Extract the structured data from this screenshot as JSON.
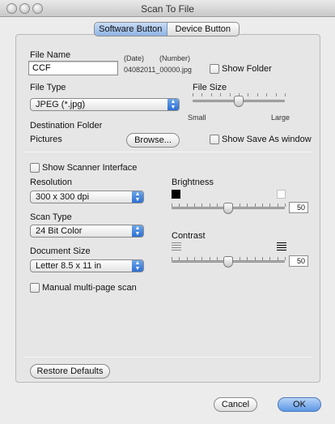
{
  "window": {
    "title": "Scan To File"
  },
  "tabs": [
    {
      "label": "Software Button",
      "selected": true
    },
    {
      "label": "Device Button",
      "selected": false
    }
  ],
  "file_name": {
    "label": "File Name",
    "value": "CCF",
    "date_label": "(Date)",
    "number_label": "(Number)",
    "example": "04082011_00000.jpg"
  },
  "show_folder": {
    "label": "Show Folder",
    "checked": false
  },
  "file_type": {
    "label": "File Type",
    "selected": "JPEG (*.jpg)"
  },
  "file_size": {
    "label": "File Size",
    "min_label": "Small",
    "max_label": "Large",
    "level": 0.5
  },
  "destination": {
    "label": "Destination Folder",
    "folder": "Pictures",
    "browse_label": "Browse..."
  },
  "show_save_as": {
    "label": "Show Save As window",
    "checked": false
  },
  "show_scanner_interface": {
    "label": "Show Scanner Interface",
    "checked": false
  },
  "resolution": {
    "label": "Resolution",
    "selected": "300 x 300 dpi"
  },
  "scan_type": {
    "label": "Scan Type",
    "selected": "24 Bit Color"
  },
  "document_size": {
    "label": "Document Size",
    "selected": "Letter  8.5 x 11 in"
  },
  "manual_multipage": {
    "label": "Manual multi-page scan",
    "checked": false
  },
  "brightness": {
    "label": "Brightness",
    "value": "50",
    "level": 0.5
  },
  "contrast": {
    "label": "Contrast",
    "value": "50",
    "level": 0.5
  },
  "buttons": {
    "restore_defaults": "Restore Defaults",
    "cancel": "Cancel",
    "ok": "OK"
  },
  "colors": {
    "accent": "#5d98e6",
    "segment_selected": "#a9c6ef"
  }
}
